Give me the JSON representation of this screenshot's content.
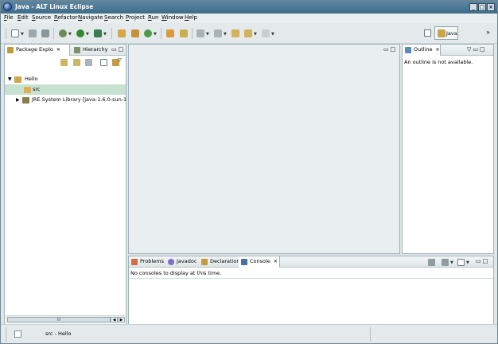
{
  "window": {
    "title": "Java - ALT Linux Eclipse"
  },
  "menu": [
    "File",
    "Edit",
    "Source",
    "Refactor",
    "Navigate",
    "Search",
    "Project",
    "Run",
    "Window",
    "Help"
  ],
  "perspective": {
    "label": "Java"
  },
  "package_explorer": {
    "tabs": [
      "Package Explo",
      "Hierarchy"
    ],
    "tree": [
      {
        "label": "Hello",
        "expanded": true
      },
      {
        "label": "src",
        "selected": true
      },
      {
        "label": "JRE System Library [java-1.6.0-sun-1.6."
      }
    ],
    "scroll_thumb": "III"
  },
  "outline": {
    "tab": "Outline",
    "message": "An outline is not available."
  },
  "bottom": {
    "tabs": [
      "Problems",
      "Javadoc",
      "Declaration",
      "Console"
    ],
    "message": "No consoles to display at this time."
  },
  "status": {
    "text": "src - Hello"
  },
  "colors": {
    "titlebar": "#4a7694",
    "selection": "#c8e2d2",
    "panel_border": "#9fb2b9"
  }
}
